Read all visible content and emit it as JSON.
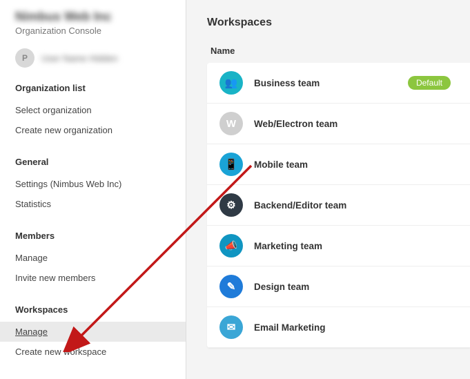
{
  "sidebar": {
    "org_title": "Nimbus Web Inc",
    "org_subtitle": "Organization Console",
    "user_initial": "P",
    "user_name": "User Name Hidden",
    "sections": {
      "org_list": {
        "header": "Organization list",
        "items": [
          "Select organization",
          "Create new organization"
        ]
      },
      "general": {
        "header": "General",
        "items": [
          "Settings (Nimbus Web Inc)",
          "Statistics"
        ]
      },
      "members": {
        "header": "Members",
        "items": [
          "Manage",
          "Invite new members"
        ]
      },
      "workspaces": {
        "header": "Workspaces",
        "items": [
          "Manage",
          "Create new workspace"
        ]
      }
    }
  },
  "main": {
    "title": "Workspaces",
    "column_header": "Name",
    "default_badge": "Default",
    "workspaces": [
      {
        "name": "Business team",
        "icon_bg": "#19b3c6",
        "icon_glyph": "👥",
        "is_default": true
      },
      {
        "name": "Web/Electron team",
        "icon_bg": "#cfcfcf",
        "icon_glyph": "W",
        "is_default": false
      },
      {
        "name": "Mobile team",
        "icon_bg": "#1aa3d6",
        "icon_glyph": "📱",
        "is_default": false
      },
      {
        "name": "Backend/Editor team",
        "icon_bg": "#2f3a45",
        "icon_glyph": "⚙",
        "is_default": false
      },
      {
        "name": "Marketing team",
        "icon_bg": "#1095c1",
        "icon_glyph": "📣",
        "is_default": false
      },
      {
        "name": "Design team",
        "icon_bg": "#1f7bd9",
        "icon_glyph": "✎",
        "is_default": false
      },
      {
        "name": "Email Marketing",
        "icon_bg": "#3aa6d6",
        "icon_glyph": "✉",
        "is_default": false
      }
    ]
  }
}
